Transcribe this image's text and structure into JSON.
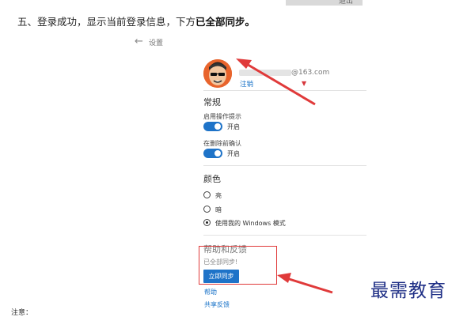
{
  "top_strip": {
    "text": "退出"
  },
  "instruction": {
    "prefix": "五、登录成功，显示当前登录信息，下方",
    "bold": "已全部同步。"
  },
  "header": {
    "back_icon": "back-arrow-icon",
    "title": "设置"
  },
  "account": {
    "email_suffix": "@163.com",
    "logout_label": "注销"
  },
  "general": {
    "heading": "常规",
    "enable_tips_label": "启用操作提示",
    "enable_tips_state": "开启",
    "confirm_delete_label": "在删除前确认",
    "confirm_delete_state": "开启"
  },
  "color": {
    "heading": "颜色",
    "options": [
      "亮",
      "暗",
      "使用我的 Windows 模式"
    ],
    "selected": "使用我的 Windows 模式"
  },
  "help": {
    "heading": "帮助和反馈",
    "sync_status": "已全部同步!",
    "sync_button": "立即同步",
    "help_link": "帮助",
    "feedback_link": "共享反馈"
  },
  "watermark": "最需教育",
  "bottom_left_text": "注意：",
  "colors": {
    "accent": "#1e73c8",
    "annotation_red": "#e03a3a",
    "watermark": "#1f2f86"
  }
}
